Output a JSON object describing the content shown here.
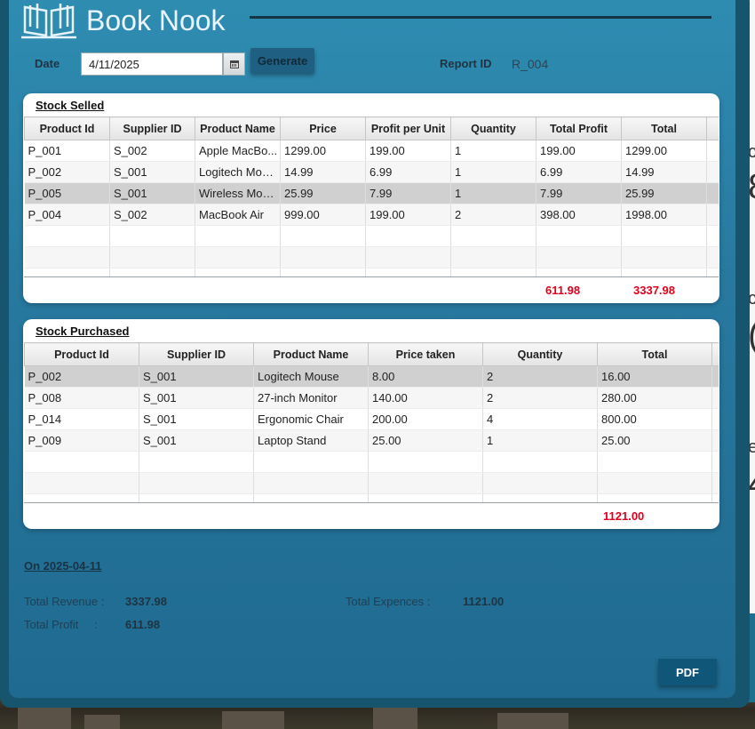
{
  "app": {
    "title": "Book Nook"
  },
  "controls": {
    "date_label": "Date",
    "date_value": "4/11/2025",
    "generate_label": "Generate",
    "report_id_label": "Report ID",
    "report_id_value": "R_004"
  },
  "stock_selled": {
    "title": "Stock Selled",
    "columns": [
      "Product Id",
      "Supplier ID",
      "Product Name",
      "Price",
      "Profit per Unit",
      "Quantity",
      "Total Profit",
      "Total"
    ],
    "rows": [
      [
        "P_001",
        "S_002",
        "Apple MacBo...",
        "1299.00",
        "199.00",
        "1",
        "199.00",
        "1299.00"
      ],
      [
        "P_002",
        "S_001",
        "Logitech Mouse",
        "14.99",
        "6.99",
        "1",
        "6.99",
        "14.99"
      ],
      [
        "P_005",
        "S_001",
        "Wireless Mouse",
        "25.99",
        "7.99",
        "1",
        "7.99",
        "25.99"
      ],
      [
        "P_004",
        "S_002",
        "MacBook Air",
        "999.00",
        "199.00",
        "2",
        "398.00",
        "1998.00"
      ]
    ],
    "total_profit": "611.98",
    "total": "3337.98"
  },
  "stock_purchased": {
    "title": "Stock Purchased",
    "columns": [
      "Product Id",
      "Supplier ID",
      "Product Name",
      "Price taken",
      "Quantity",
      "Total"
    ],
    "rows": [
      [
        "P_002",
        "S_001",
        "Logitech Mouse",
        "8.00",
        "2",
        "16.00"
      ],
      [
        "P_008",
        "S_001",
        "27-inch Monitor",
        "140.00",
        "2",
        "280.00"
      ],
      [
        "P_014",
        "S_001",
        "Ergonomic Chair",
        "200.00",
        "4",
        "800.00"
      ],
      [
        "P_009",
        "S_001",
        "Laptop Stand",
        "25.00",
        "1",
        "25.00"
      ]
    ],
    "total": "1121.00"
  },
  "summary": {
    "heading": "On 2025-04-11",
    "revenue_label": "Total Revenue",
    "revenue_value": "3337.98",
    "expences_label": "Total Expences",
    "expences_value": "1121.00",
    "profit_label": "Total Profit",
    "profit_value": "611.98"
  },
  "pdf_label": "PDF",
  "background_text": [
    "c",
    "8",
    "c",
    "(",
    "e",
    "4"
  ],
  "colors": {
    "accent": "#2f8db2",
    "total_red": "#e0001b",
    "button": "#0f5678"
  }
}
